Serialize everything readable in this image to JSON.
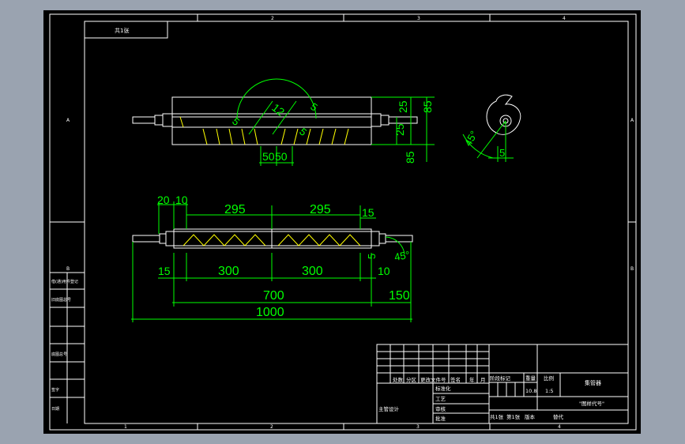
{
  "colors": {
    "viewport": "#9aa3b0",
    "paper": "#000000",
    "frame": "#ffffff",
    "dimension": "#00ff00",
    "hatch": "#ffff00"
  },
  "border": {
    "columns_top": [
      "2",
      "3",
      "4"
    ],
    "columns_bottom": [
      "1",
      "2",
      "3",
      "4"
    ],
    "rows_left": [
      "A",
      "B"
    ],
    "rows_right": [
      "A",
      "B"
    ]
  },
  "tag_box": "共1张",
  "side_labels": [
    "借(通)用件登记",
    "旧底图总号",
    "底图总号",
    "签字",
    "日期"
  ],
  "dimensions": {
    "top_view": [
      "12",
      "5",
      "85",
      "25",
      "25",
      "5",
      "5",
      "50",
      "50",
      "85"
    ],
    "section": [
      "45°",
      "5"
    ],
    "front_view": [
      "20",
      "10",
      "295",
      "295",
      "15",
      "15",
      "300",
      "300",
      "10",
      "5",
      "45°",
      "700",
      "150",
      "1000"
    ]
  },
  "title_block": {
    "change_headers": [
      "处数",
      "分区",
      "更改文件号",
      "签名",
      "年",
      "月"
    ],
    "stage_headers": [
      "阶段标记",
      "重量",
      "比例"
    ],
    "scale": "1:5",
    "weight": "10.8",
    "part_name": "集管器",
    "drawing_code": "\"图样代号\"",
    "rows": {
      "designer": "主管设计",
      "standard": "标准化",
      "process": "工艺",
      "review": "审核",
      "approve": "批准"
    },
    "footer": [
      "共1张",
      "第1张",
      "版本",
      "替代"
    ]
  }
}
